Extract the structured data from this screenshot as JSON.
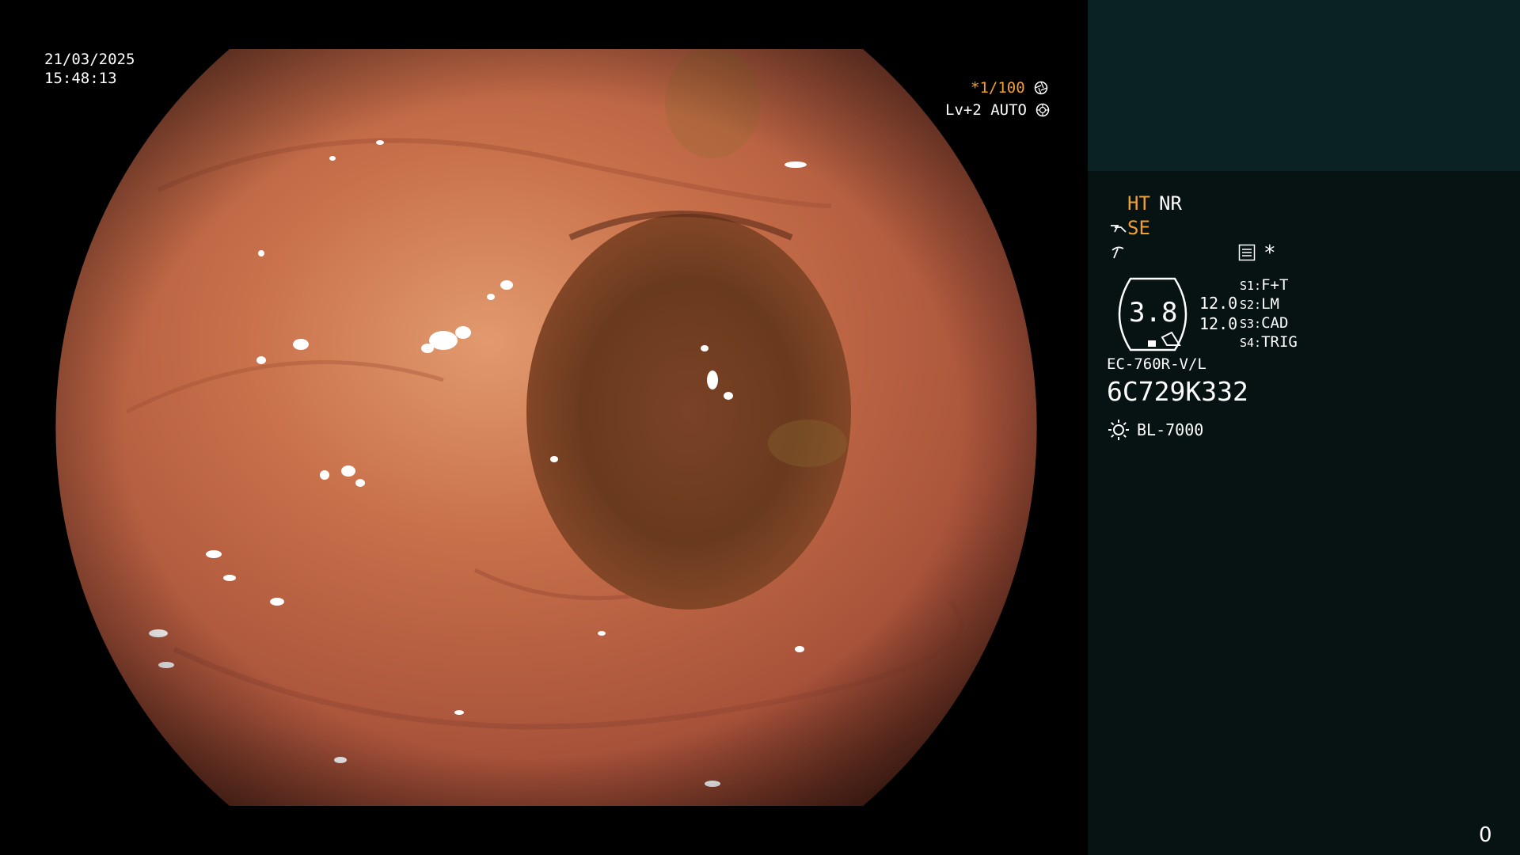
{
  "overlay": {
    "date": "21/03/2025",
    "time": "15:48:13",
    "shutter": "*1/100",
    "level": "Lv+2 AUTO"
  },
  "panel": {
    "ht_label": "HT",
    "nr_label": "NR",
    "se_label": "SE",
    "asterisk": "*",
    "gauge_value": "3.8",
    "value_a": "12.0",
    "value_b": "12.0",
    "switches": [
      {
        "key": "S1:",
        "value": "F+T"
      },
      {
        "key": "S2:",
        "value": "LM"
      },
      {
        "key": "S3:",
        "value": "CAD"
      },
      {
        "key": "S4:",
        "value": "TRIG"
      }
    ],
    "scope_model": "EC-760R-V/L",
    "serial": "6C729K332",
    "light_source": "BL-7000"
  },
  "footer": {
    "counter": "0"
  },
  "colors": {
    "accent": "#f0a030",
    "text": "#ffffff",
    "panel_top": "#0b2224",
    "panel_bg": "#071212"
  },
  "icons": [
    "aperture-icon",
    "iris-icon",
    "scope-icon",
    "lightning-icon",
    "menu-icon",
    "light-icon"
  ]
}
